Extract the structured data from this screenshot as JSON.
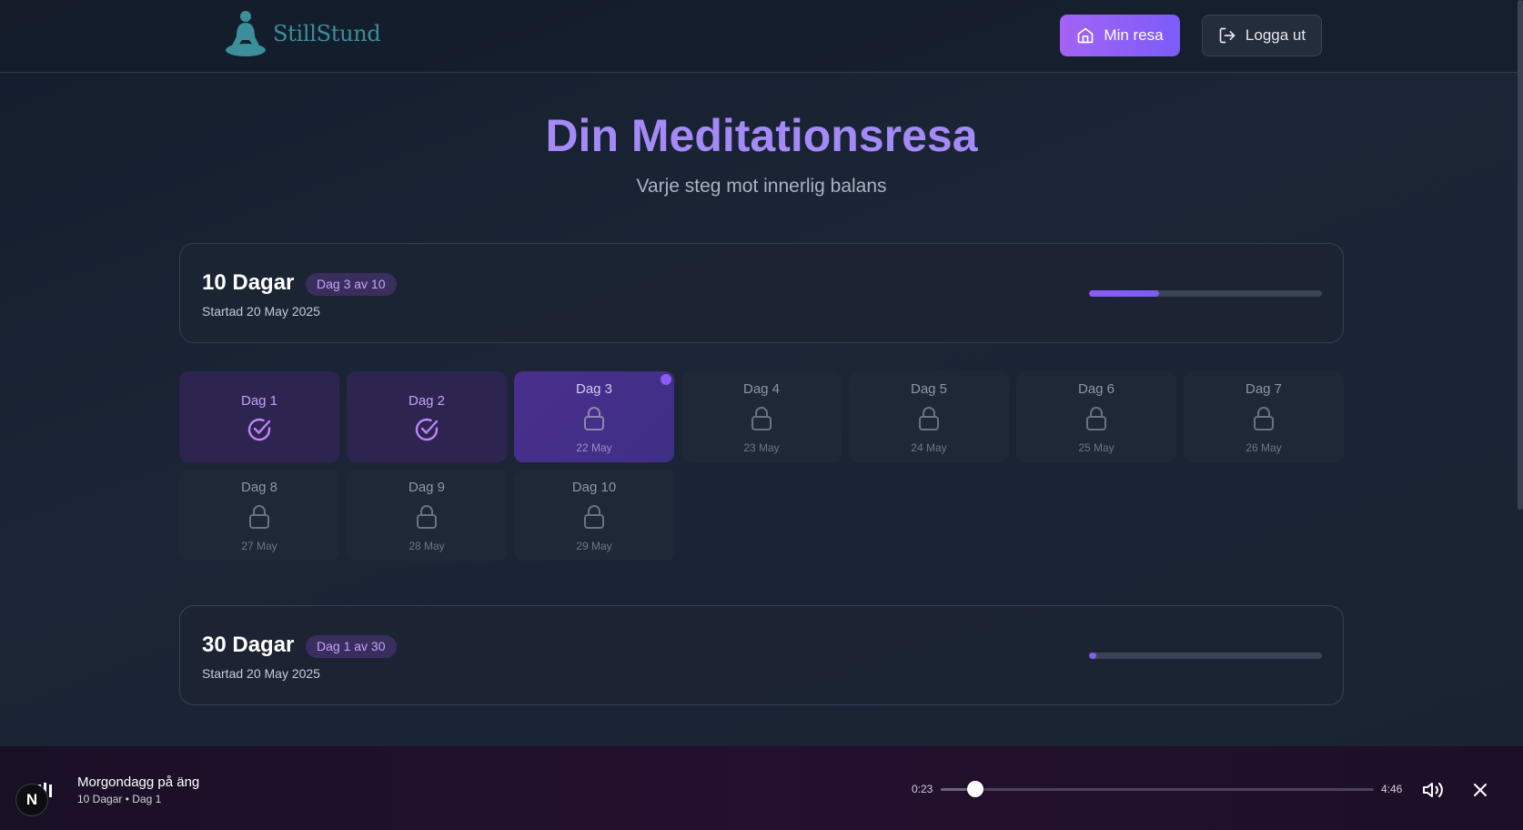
{
  "header": {
    "logo_text": "StillStund",
    "nav": {
      "my_journey_label": "Min resa",
      "logout_label": "Logga ut"
    }
  },
  "hero": {
    "title": "Din Meditationsresa",
    "subtitle": "Varje steg mot innerlig balans"
  },
  "courses": [
    {
      "title": "10 Dagar",
      "badge": "Dag 3 av 10",
      "started": "Startad 20 May 2025",
      "progress": 0.3
    },
    {
      "title": "30 Dagar",
      "badge": "Dag 1 av 30",
      "started": "Startad 20 May 2025",
      "progress": 0.033
    }
  ],
  "days": [
    {
      "label": "Dag 1",
      "date": "",
      "state": "done"
    },
    {
      "label": "Dag 2",
      "date": "",
      "state": "done"
    },
    {
      "label": "Dag 3",
      "date": "22 May",
      "state": "current"
    },
    {
      "label": "Dag 4",
      "date": "23 May",
      "state": "locked"
    },
    {
      "label": "Dag 5",
      "date": "24 May",
      "state": "locked"
    },
    {
      "label": "Dag 6",
      "date": "25 May",
      "state": "locked"
    },
    {
      "label": "Dag 7",
      "date": "26 May",
      "state": "locked"
    },
    {
      "label": "Dag 8",
      "date": "27 May",
      "state": "locked"
    },
    {
      "label": "Dag 9",
      "date": "28 May",
      "state": "locked"
    },
    {
      "label": "Dag 10",
      "date": "29 May",
      "state": "locked"
    }
  ],
  "player": {
    "track_title": "Morgondagg på äng",
    "track_subtitle": "10 Dagar • Dag 1",
    "current_time": "0:23",
    "duration": "4:46",
    "progress": 0.08
  },
  "dev_badge": "N",
  "icons": {
    "home": "home-icon",
    "logout": "logout-icon",
    "check": "check-circle-icon",
    "lock": "lock-icon",
    "volume": "volume-icon",
    "close": "close-icon"
  },
  "colors": {
    "accent": "#a48af7",
    "primary_button": "#a363f5",
    "badge_bg": "#3a2e5e",
    "badge_text": "#c4a5fb",
    "logo": "#3a8f9a"
  }
}
